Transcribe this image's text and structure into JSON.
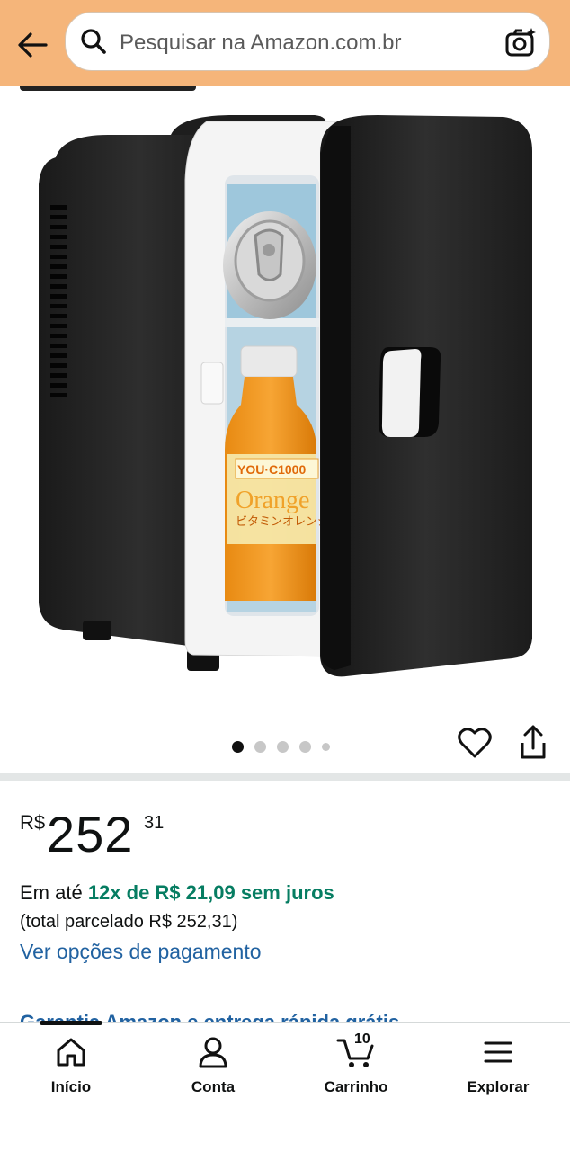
{
  "header": {
    "search_placeholder": "Pesquisar na Amazon.com.br",
    "icons": {
      "back": "arrow-left-icon",
      "search": "search-icon",
      "camera": "camera-scan-icon"
    }
  },
  "gallery": {
    "image_alt": "Mini geladeira preta com porta aberta",
    "image_count": 5,
    "active_index": 1,
    "product_labels": {
      "bottle_brand": "YOU·C1000",
      "bottle_text": "Orange",
      "bottle_jp": "ビタミンオレンジ"
    }
  },
  "price": {
    "currency": "R$",
    "whole": "252",
    "fraction": "31"
  },
  "installments": {
    "prefix": "Em até ",
    "highlight": "12x de R$ 21,09 sem juros",
    "total": "(total parcelado R$ 252,31)",
    "payment_link": "Ver opções de pagamento"
  },
  "cutoff_link": "Garantia Amazon e entrega rápida grátis",
  "bottom_nav": {
    "items": [
      {
        "label": "Início",
        "icon": "home-icon"
      },
      {
        "label": "Conta",
        "icon": "user-icon"
      },
      {
        "label": "Carrinho",
        "icon": "cart-icon"
      },
      {
        "label": "Explorar",
        "icon": "menu-icon"
      }
    ],
    "cart_count": "10"
  },
  "colors": {
    "header_bg": "#f5b57a",
    "green": "#067d62",
    "link": "#2162a1"
  }
}
